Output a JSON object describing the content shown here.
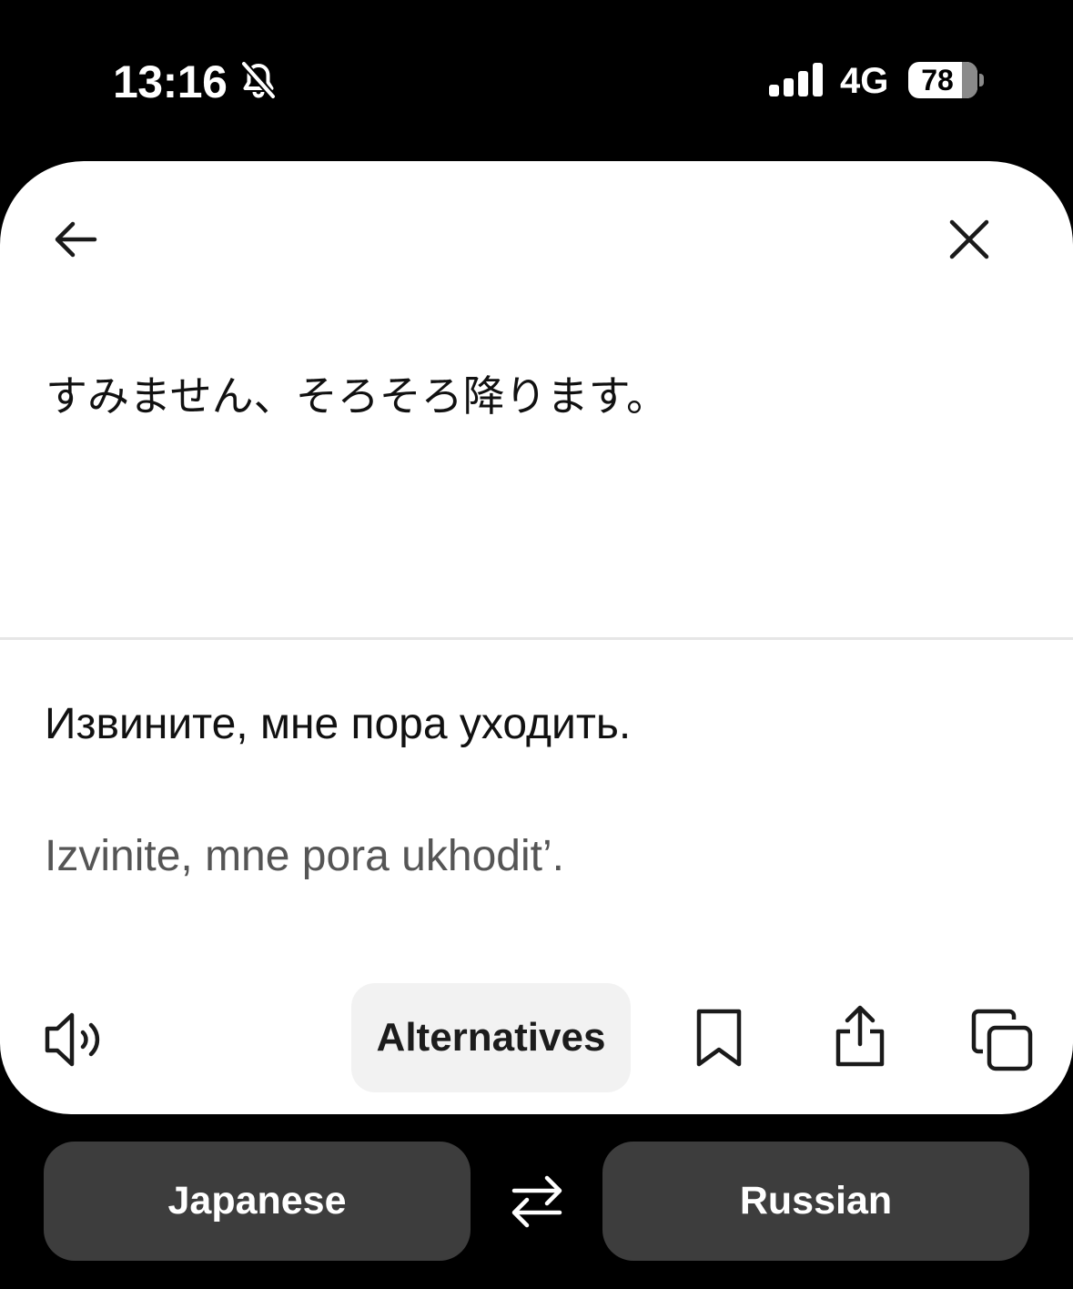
{
  "status_bar": {
    "time": "13:16",
    "network": "4G",
    "battery_level": "78",
    "battery_fraction": 0.78,
    "icons": [
      "bell-slash-icon",
      "cellular-signal-icon",
      "battery-icon"
    ]
  },
  "header": {
    "icons": [
      "arrow-left-icon",
      "close-x-icon"
    ]
  },
  "translation": {
    "source_text": "すみません、そろそろ降ります。",
    "target_text": "Извините, мне пора уходить.",
    "transliteration": "Izvinite, mne pora ukhodit’."
  },
  "toolbar": {
    "alternatives_label": "Alternatives",
    "icons": [
      "speaker-icon",
      "bookmark-icon",
      "share-icon",
      "copy-icon"
    ]
  },
  "languages": {
    "source": "Japanese",
    "target": "Russian",
    "swap_icon": "swap-arrows-icon"
  },
  "colors": {
    "background": "#000000",
    "card": "#ffffff",
    "chip": "#f2f2f2",
    "language_button": "#3d3d3d",
    "secondary_text": "#555555"
  }
}
